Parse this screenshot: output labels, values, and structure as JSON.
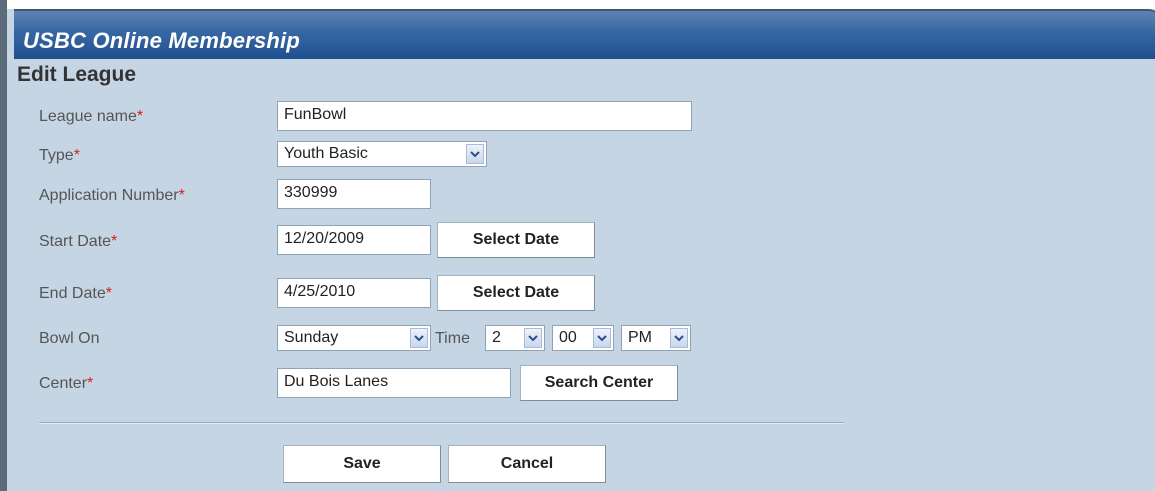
{
  "header": {
    "title": "USBC Online Membership"
  },
  "form": {
    "section_title": "Edit League",
    "required_mark": "*",
    "league_name": {
      "label": "League name",
      "value": "FunBowl"
    },
    "type": {
      "label": "Type",
      "value": "Youth Basic"
    },
    "application_number": {
      "label": "Application Number",
      "value": "330999"
    },
    "start_date": {
      "label": "Start Date",
      "value": "12/20/2009",
      "button": "Select Date"
    },
    "end_date": {
      "label": "End Date",
      "value": "4/25/2010",
      "button": "Select Date"
    },
    "bowl_on": {
      "label": "Bowl On",
      "day": "Sunday",
      "time_label": "Time",
      "hour": "2",
      "minute": "00",
      "ampm": "PM"
    },
    "center": {
      "label": "Center",
      "value": "Du Bois Lanes",
      "button": "Search Center"
    },
    "save_label": "Save",
    "cancel_label": "Cancel"
  },
  "colors": {
    "background": "#c5d5e4",
    "header": "#2f5d99",
    "required": "#d81e1e"
  }
}
